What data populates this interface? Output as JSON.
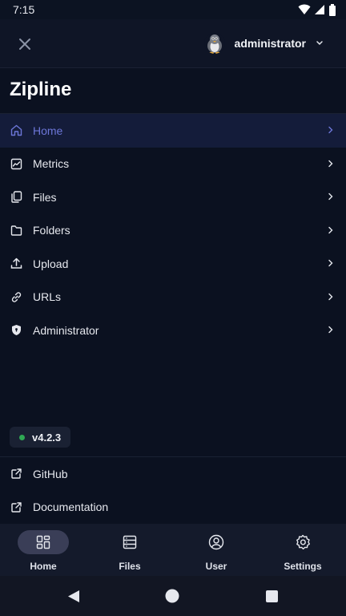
{
  "status_bar": {
    "time": "7:15"
  },
  "header": {
    "user_name": "administrator"
  },
  "app": {
    "title": "Zipline"
  },
  "nav": {
    "items": [
      {
        "label": "Home",
        "icon": "home-icon",
        "active": true
      },
      {
        "label": "Metrics",
        "icon": "chart-icon",
        "active": false
      },
      {
        "label": "Files",
        "icon": "files-icon",
        "active": false
      },
      {
        "label": "Folders",
        "icon": "folder-icon",
        "active": false
      },
      {
        "label": "Upload",
        "icon": "upload-icon",
        "active": false
      },
      {
        "label": "URLs",
        "icon": "link-icon",
        "active": false
      },
      {
        "label": "Administrator",
        "icon": "shield-icon",
        "active": false
      }
    ]
  },
  "version": {
    "label": "v4.2.3",
    "status_color": "#2fa854"
  },
  "links": [
    {
      "label": "GitHub",
      "icon": "external-link-icon"
    },
    {
      "label": "Documentation",
      "icon": "external-link-icon"
    }
  ],
  "bottom_nav": [
    {
      "label": "Home",
      "icon": "dashboard-icon",
      "active": true
    },
    {
      "label": "Files",
      "icon": "file-list-icon",
      "active": false
    },
    {
      "label": "User",
      "icon": "user-icon",
      "active": false
    },
    {
      "label": "Settings",
      "icon": "gear-icon",
      "active": false
    }
  ],
  "colors": {
    "accent": "#6c76d8",
    "background": "#0b1120",
    "active_row": "#141c3a"
  }
}
